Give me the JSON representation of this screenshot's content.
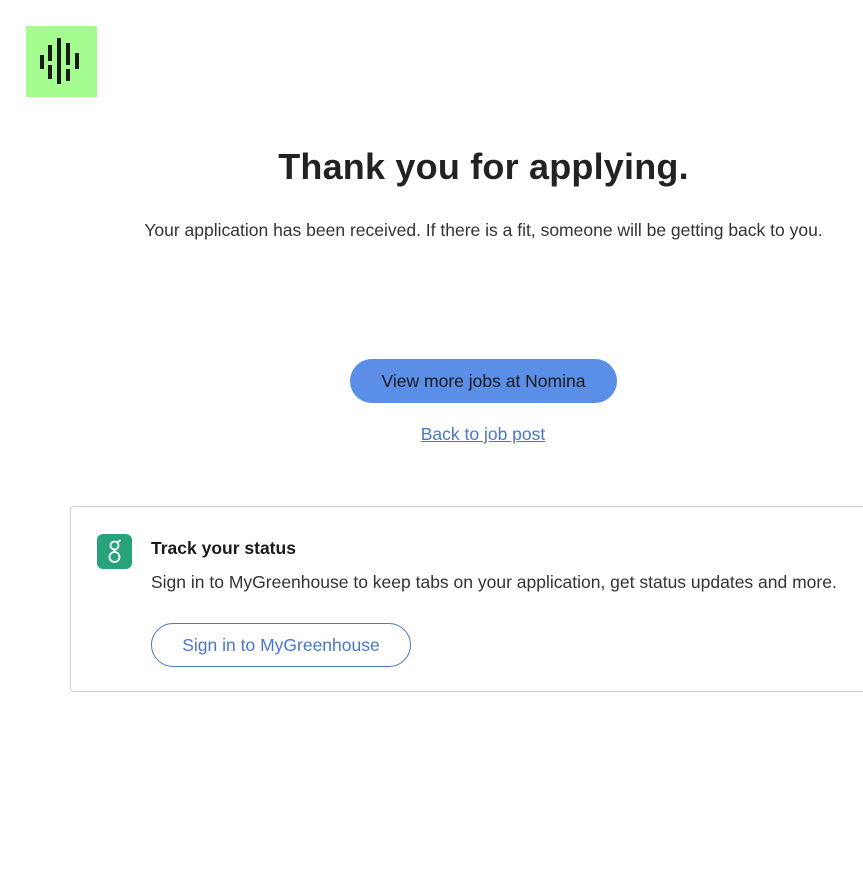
{
  "logo": {
    "background_color": "#a5fd90",
    "bars_color": "#1a1a1a"
  },
  "heading": {
    "title": "Thank you for applying.",
    "subtitle": "Your application has been received. If there is a fit, someone will be getting back to you."
  },
  "actions": {
    "view_jobs_label": "View more jobs at Nomina",
    "back_link_label": "Back to job post",
    "primary_color": "#5b8ee6",
    "link_color": "#4a78c8"
  },
  "track_card": {
    "icon": "greenhouse-icon",
    "icon_color": "#27a37c",
    "title": "Track your status",
    "text": "Sign in to MyGreenhouse to keep tabs on your application, get status updates and more.",
    "signin_label": "Sign in to MyGreenhouse"
  }
}
